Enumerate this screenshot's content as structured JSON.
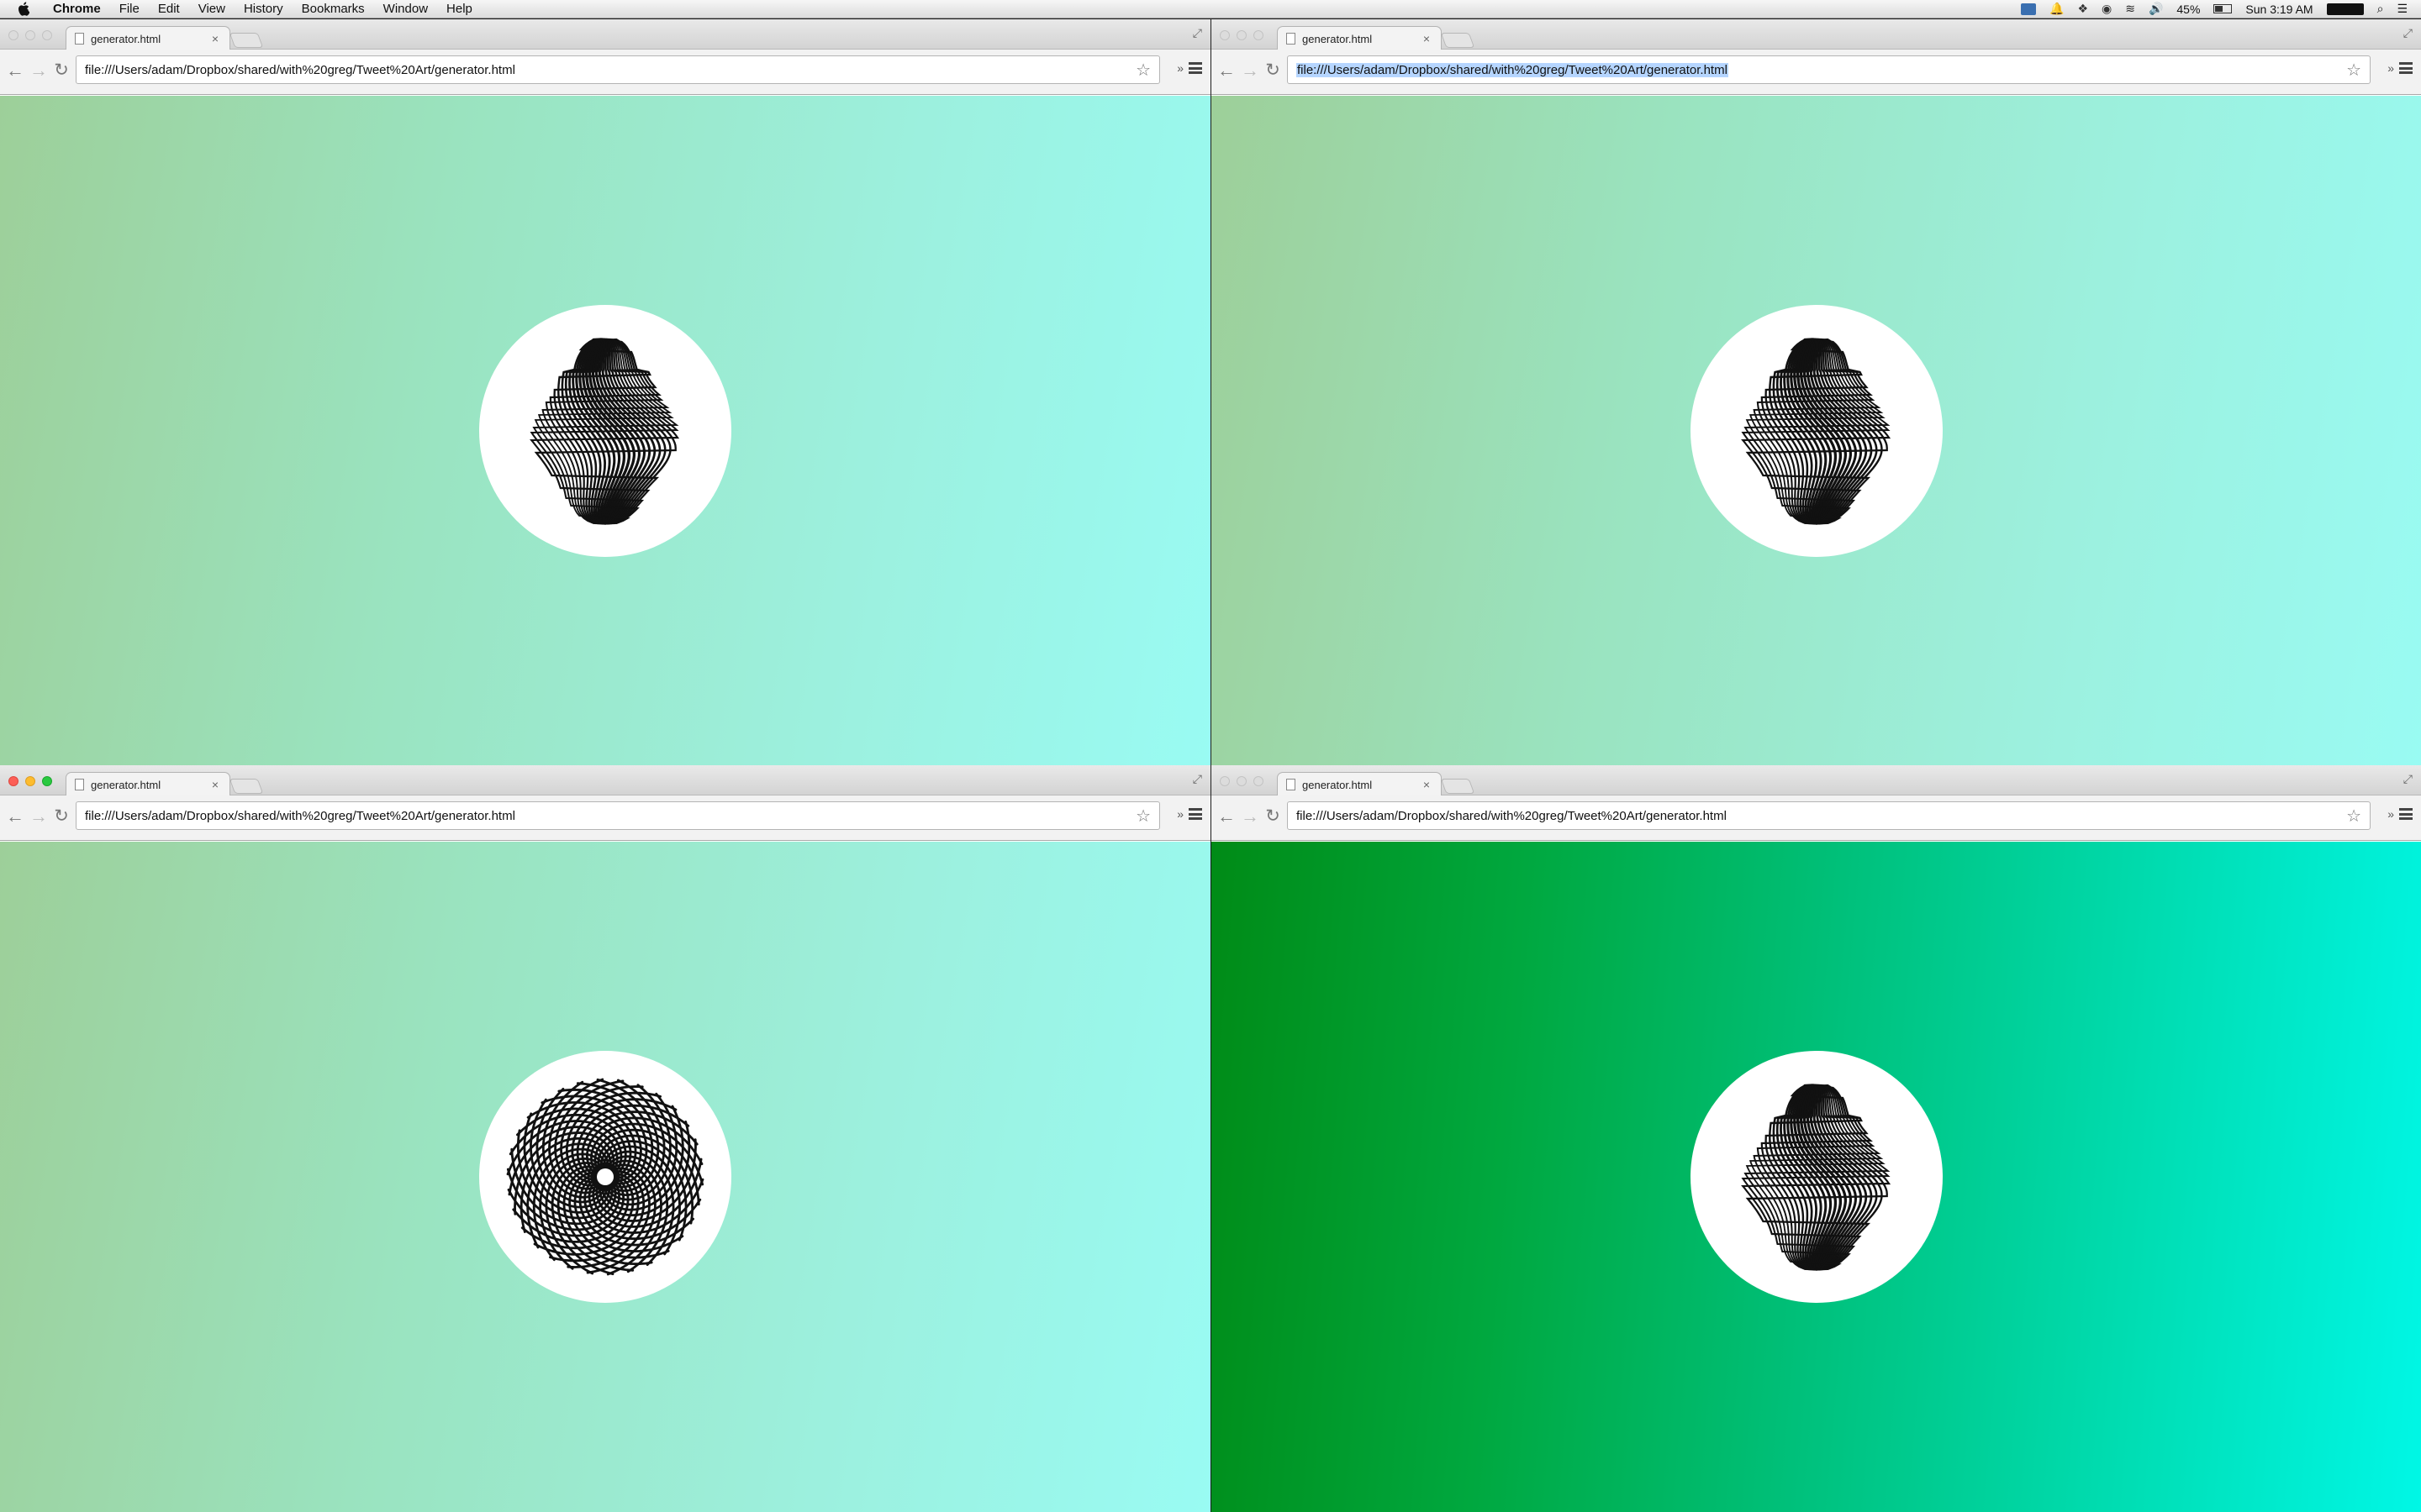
{
  "menubar": {
    "app": "Chrome",
    "items": [
      "File",
      "Edit",
      "View",
      "History",
      "Bookmarks",
      "Window",
      "Help"
    ],
    "battery": "45%",
    "clock": "Sun 3:19 AM"
  },
  "windows": [
    {
      "tab_title": "generator.html",
      "close": "×",
      "url": "file:///Users/adam/Dropbox/shared/with%20greg/Tweet%20Art/generator.html",
      "art": "twisted-blob"
    },
    {
      "tab_title": "generator.html",
      "close": "×",
      "url": "file:///Users/adam/Dropbox/shared/with%20greg/Tweet%20Art/generator.html",
      "art": "twisted-blob",
      "url_selected": true
    },
    {
      "tab_title": "generator.html",
      "close": "×",
      "url": "file:///Users/adam/Dropbox/shared/with%20greg/Tweet%20Art/generator.html",
      "art": "spiral-swirl",
      "active": true
    },
    {
      "tab_title": "generator.html",
      "close": "×",
      "url": "file:///Users/adam/Dropbox/shared/with%20greg/Tweet%20Art/generator.html",
      "art": "twisted-blob"
    }
  ],
  "colors": {
    "light_gradient": [
      "#9dcf99",
      "#99fbf3"
    ],
    "bright_gradient": [
      "#008b16",
      "#00f7e6"
    ]
  },
  "icons": {
    "back": "←",
    "forward": "→",
    "reload": "↻",
    "star": "☆",
    "extensions": "»",
    "fullscreen": "⤢"
  }
}
